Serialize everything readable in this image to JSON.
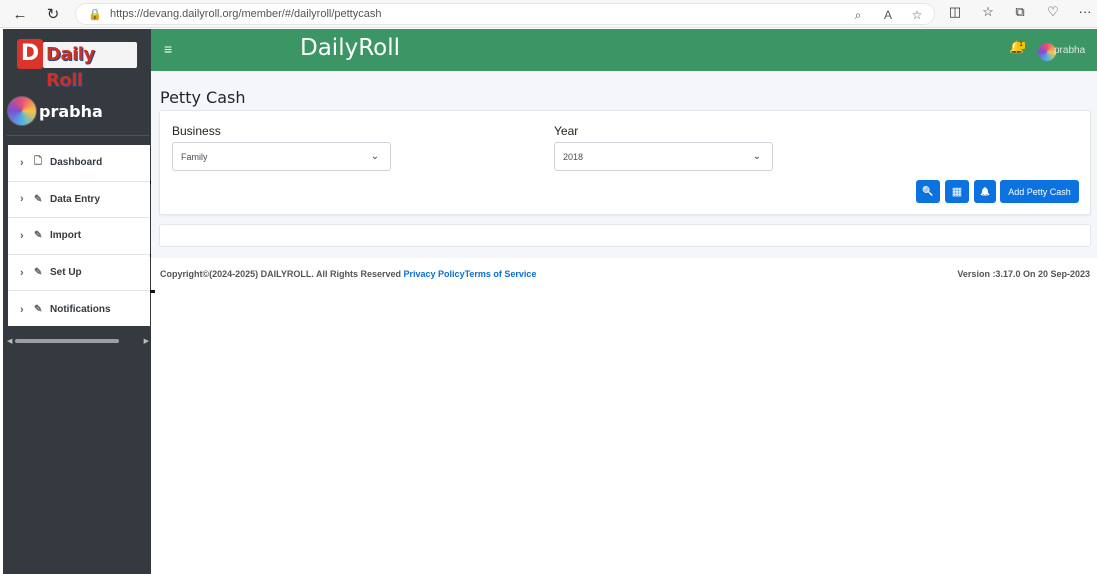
{
  "browser": {
    "url": "https://devang.dailyroll.org/member/#/dailyroll/pettycash",
    "back_icon": "←",
    "reload_icon": "↻",
    "lock_icon": "🔒",
    "zoom_icon": "⌕",
    "read_aloud_icon": "A",
    "favorite_icon": "☆",
    "split_icon": "◫",
    "favorites_icon": "☆",
    "collections_icon": "⧉",
    "extensions_icon": "♡",
    "more_icon": "···"
  },
  "sidebar": {
    "logo_letter": "D",
    "logo_text": "Daily Roll",
    "user_name": "prabha",
    "items": [
      {
        "label": "Dashboard",
        "icon": "file-icon",
        "glyph": "🗋",
        "chevron": "›"
      },
      {
        "label": "Data Entry",
        "icon": "pencil-icon",
        "glyph": "✎",
        "chevron": "›"
      },
      {
        "label": "Import",
        "icon": "pencil-icon",
        "glyph": "✎",
        "chevron": "›"
      },
      {
        "label": "Set Up",
        "icon": "pencil-icon",
        "glyph": "✎",
        "chevron": "›"
      },
      {
        "label": "Notifications",
        "icon": "pencil-icon",
        "glyph": "✎",
        "chevron": "›"
      }
    ]
  },
  "header": {
    "menu_icon": "≡",
    "brand": "DailyRoll",
    "bell_icon": "🔔",
    "notification_count": "1",
    "user_name": "prabha"
  },
  "main": {
    "title": "Petty Cash",
    "business_label": "Business",
    "business_value": "Family",
    "year_label": "Year",
    "year_value": "2018",
    "chevron": "⌄",
    "search_icon": "🔍",
    "table_icon": "▦",
    "bell_icon": "🔔",
    "add_button": "Add Petty Cash"
  },
  "footer": {
    "copyright": "Copyright©(2024-2025) DAILYROLL. All Rights Reserved ",
    "privacy": "Privacy Policy",
    "terms": "Terms of Service",
    "version": "Version :3.17.0 On 20 Sep-2023"
  },
  "colors": {
    "header_bg": "#3b9565",
    "sidebar_bg": "#343a40",
    "button_bg": "#0b72e0",
    "link": "#0b6fd6"
  }
}
